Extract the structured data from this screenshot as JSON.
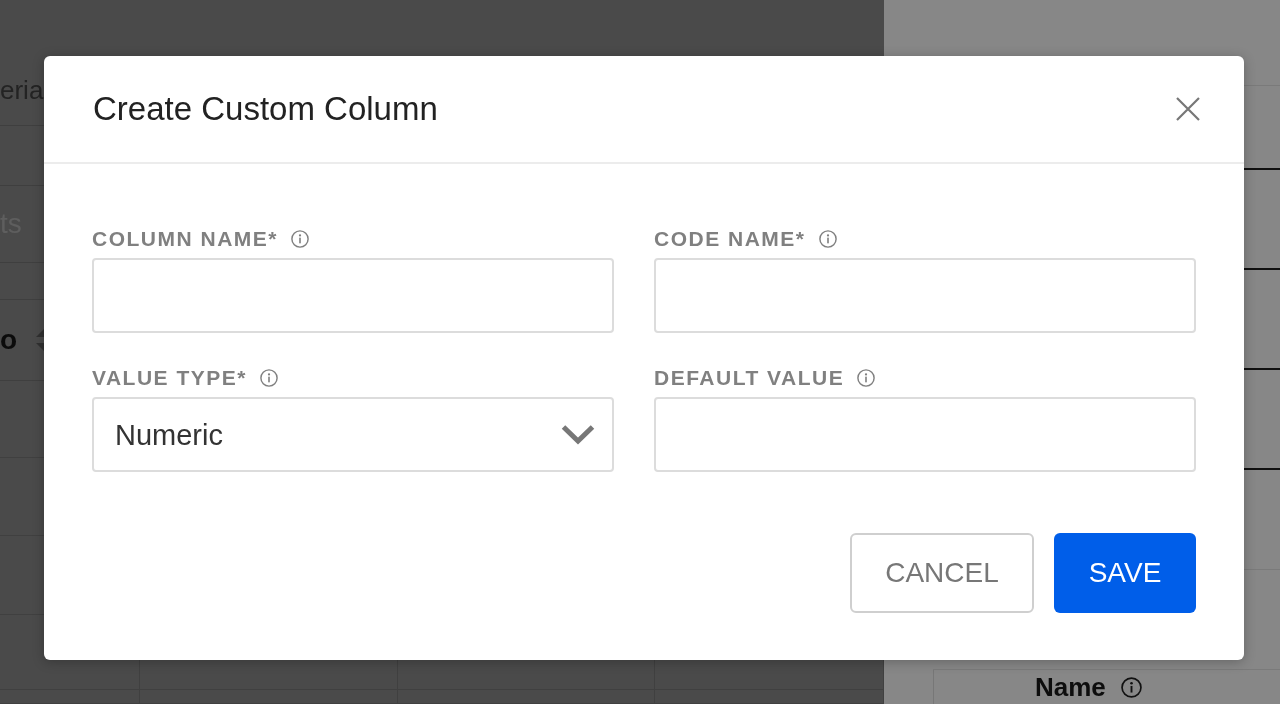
{
  "background": {
    "heading": "eria",
    "faded_text": "ts",
    "table_header": "o",
    "side_panel": {
      "column_header": "Name"
    }
  },
  "dialog": {
    "title": "Create Custom Column",
    "fields": [
      {
        "label": "COLUMN NAME*",
        "kind": "text"
      },
      {
        "label": "CODE NAME*",
        "kind": "text"
      },
      {
        "label": "VALUE TYPE*",
        "kind": "select",
        "value": "Numeric"
      },
      {
        "label": "DEFAULT VALUE",
        "kind": "text"
      }
    ],
    "buttons": [
      {
        "label": "CANCEL",
        "kind": "secondary"
      },
      {
        "label": "SAVE",
        "kind": "primary"
      }
    ]
  }
}
